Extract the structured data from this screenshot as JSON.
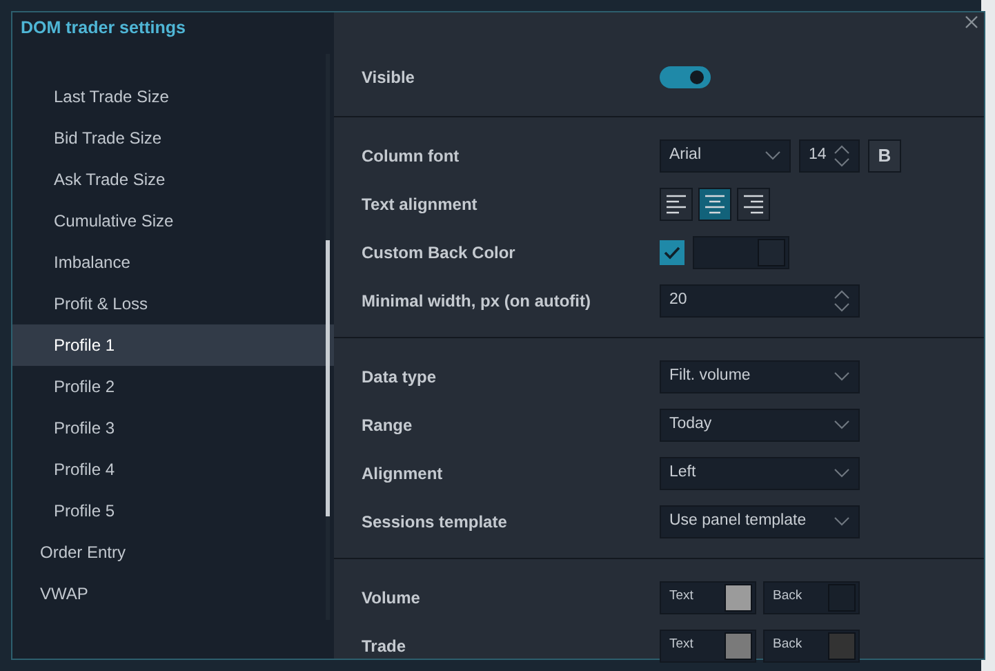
{
  "window": {
    "title": "DOM trader settings"
  },
  "sidebar": {
    "items": [
      {
        "children": [
          {
            "label": "Last Trade Size",
            "selected": false
          },
          {
            "label": "Bid Trade Size",
            "selected": false
          },
          {
            "label": "Ask Trade Size",
            "selected": false
          },
          {
            "label": "Cumulative Size",
            "selected": false
          },
          {
            "label": "Imbalance",
            "selected": false
          },
          {
            "label": "Profit & Loss",
            "selected": false
          },
          {
            "label": "Profile 1",
            "selected": true
          },
          {
            "label": "Profile 2",
            "selected": false
          },
          {
            "label": "Profile 3",
            "selected": false
          },
          {
            "label": "Profile 4",
            "selected": false
          },
          {
            "label": "Profile 5",
            "selected": false
          }
        ]
      },
      {
        "label": "Order Entry",
        "selected": false
      },
      {
        "label": "VWAP",
        "selected": false
      }
    ]
  },
  "sections": [
    {
      "rows": [
        {
          "kind": "toggle",
          "label": "Visible",
          "on": true
        }
      ]
    },
    {
      "rows": [
        {
          "kind": "font",
          "label": "Column font",
          "font": "Arial",
          "size": "14",
          "bold_label": "B",
          "bold": false
        },
        {
          "kind": "alignment",
          "label": "Text alignment",
          "options": [
            {
              "kind": "left",
              "selected": false
            },
            {
              "kind": "center",
              "selected": true
            },
            {
              "kind": "right",
              "selected": false
            }
          ]
        },
        {
          "kind": "backcolor",
          "label": "Custom Back Color",
          "checked": true,
          "color": "#1e2631"
        },
        {
          "kind": "spin",
          "label": "Minimal width, px (on autofit)",
          "value": "20"
        }
      ]
    },
    {
      "rows": [
        {
          "kind": "select",
          "label": "Data type",
          "value": "Filt. volume"
        },
        {
          "kind": "select",
          "label": "Range",
          "value": "Today"
        },
        {
          "kind": "select",
          "label": "Alignment",
          "value": "Left"
        },
        {
          "kind": "select",
          "label": "Sessions template",
          "value": "Use panel template"
        }
      ]
    },
    {
      "rows": [
        {
          "kind": "colors",
          "label": "Volume",
          "pair": [
            {
              "label": "Text",
              "color": "#9b9b9b"
            },
            {
              "label": "Back",
              "color": "#18202a"
            }
          ]
        },
        {
          "kind": "colors",
          "label": "Trade",
          "pair": [
            {
              "label": "Text",
              "color": "#7a7a7a"
            },
            {
              "label": "Back",
              "color": "#333333"
            }
          ]
        }
      ]
    }
  ]
}
